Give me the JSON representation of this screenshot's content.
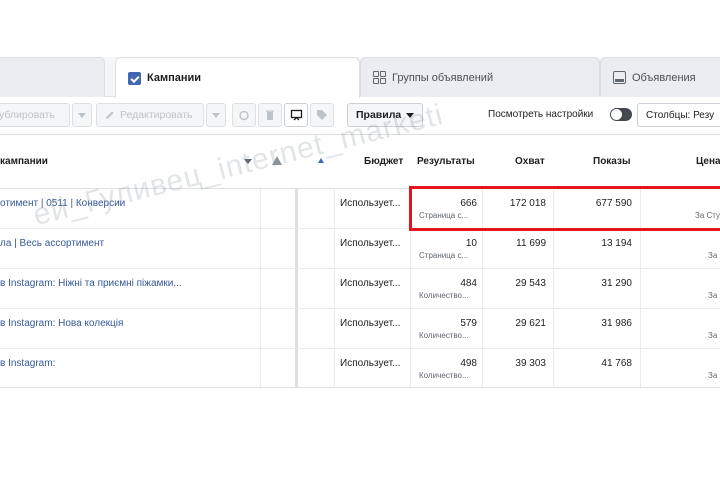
{
  "tabs": [
    {
      "label": "Кампании",
      "icon": "folder-icon",
      "active": true
    },
    {
      "label": "Группы объявлений",
      "icon": "grid-icon",
      "active": false
    },
    {
      "label": "Объявления",
      "icon": "ad-icon",
      "active": false
    }
  ],
  "toolbar": {
    "duplicate_label": "ублировать",
    "edit_label": "Редактировать",
    "rules_label": "Правила",
    "view_settings_label": "Посмотреть настройки",
    "columns_label": "Столбцы: Резу"
  },
  "table": {
    "headers": {
      "name": "кампании",
      "budget": "Бюджет",
      "results": "Результаты",
      "reach": "Охват",
      "impressions": "Показы",
      "cost": "Цена"
    },
    "rows": [
      {
        "name": "отимент | 0511 | Конверсии",
        "budget": "Использует...",
        "results": "666",
        "result_type": "Страница с...",
        "reach": "172 018",
        "impressions": "677 590",
        "cost_sub": "За Сту"
      },
      {
        "name": "ла | Весь ассортимент",
        "budget": "Использует...",
        "results": "10",
        "result_type": "Страница с...",
        "reach": "11 699",
        "impressions": "13 194",
        "cost_sub": "За"
      },
      {
        "name": "в Instagram: Ніжні та приємні піжамки...",
        "budget": "Использует...",
        "results": "484",
        "result_type": "Количество...",
        "reach": "29 543",
        "impressions": "31 290",
        "cost_sub": "За"
      },
      {
        "name": "в Instagram: Нова колекція",
        "budget": "Использует...",
        "results": "579",
        "result_type": "Количество...",
        "reach": "29 621",
        "impressions": "31 986",
        "cost_sub": "За"
      },
      {
        "name": "в Instagram:",
        "budget": "Использует...",
        "results": "498",
        "result_type": "Количество...",
        "reach": "39 303",
        "impressions": "41 768",
        "cost_sub": "За"
      }
    ]
  },
  "watermark": "ей_Гуливец_internet_marketi",
  "colors": {
    "link": "#365899",
    "highlight": "#e4151f",
    "active_tab_icon": "#4267b2"
  }
}
